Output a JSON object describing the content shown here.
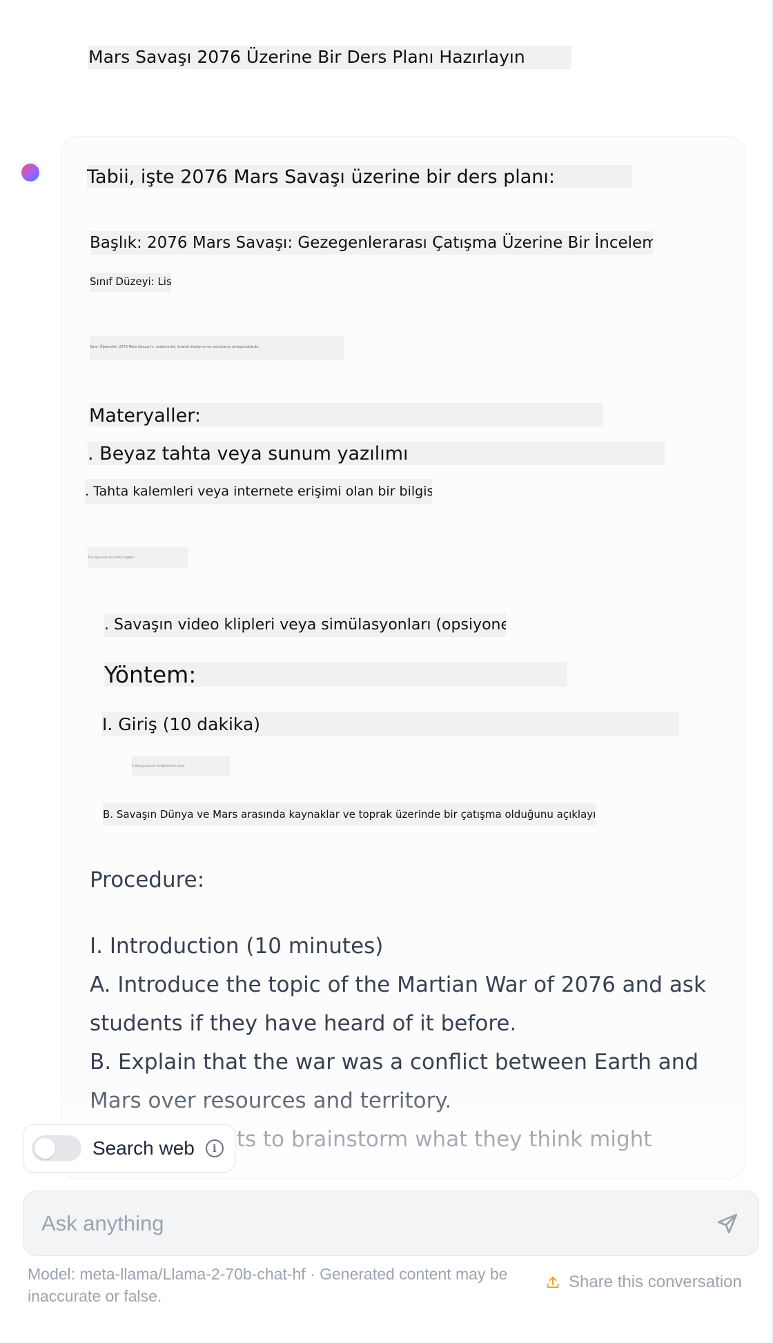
{
  "conversation": {
    "user_message": "Mars Savaşı 2076 Üzerine Bir Ders Planı Hazırlayın",
    "assistant": {
      "intro": "Tabii, işte 2076 Mars Savaşı üzerine bir ders planı:",
      "title": "Başlık: 2076 Mars Savaşı: Gezegenlerarası Çatışma Üzerine Bir İnceleme",
      "grade": "Sınıf Düzeyi: Lise",
      "tiny_line_1": "Süre: Öğrenciler 2076 Mars Savaşı'nı, nedenlerini, önemli olaylarını ve sonuçlarını anlayacaklardır.",
      "materials_heading": "Materyaller:",
      "material_1": ". Beyaz tahta veya sunum yazılımı",
      "material_2": ". Tahta kalemleri veya internete erişimi olan bir bilgisayar",
      "tiny_line_2": "Tüm öğrenciler için bildiri kağıtları",
      "material_3": ". Savaşın video klipleri veya simülasyonları (opsiyonel)",
      "procedure_heading_tr": "Yöntem:",
      "intro_section_tr": "I. Giriş (10 dakika)",
      "tiny_line_3": "A. Konuyu tanıtın ve öğrencilere sorun",
      "explain_tr": "B. Savaşın Dünya ve Mars arasında kaynaklar ve toprak üzerinde bir çatışma olduğunu açıklayın.",
      "procedure_heading_en": "Procedure:",
      "intro_section_en": "I. Introduction (10 minutes)",
      "step_a_en": "A. Introduce the topic of the Martian War of 2076 and ask students if they have heard of it before.",
      "step_b_en": "B. Explain that the war was a conflict between Earth and Mars over resources and territory.",
      "step_c_partial": "C. Ask students to brainstorm what they think might"
    }
  },
  "search_web": {
    "label": "Search web",
    "enabled": false
  },
  "composer": {
    "placeholder": "Ask anything"
  },
  "footer": {
    "model_note": "Model: meta-llama/Llama-2-70b-chat-hf · Generated content may be inaccurate or false.",
    "share_label": "Share this conversation"
  },
  "colors": {
    "highlight": "#f1f1f2",
    "muted_text": "#9ca3af",
    "share_accent": "#f59e0b",
    "body_text": "#374151"
  }
}
